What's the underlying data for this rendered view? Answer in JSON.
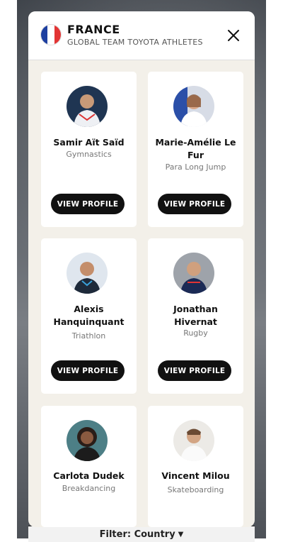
{
  "modal": {
    "title": "FRANCE",
    "subtitle": "GLOBAL TEAM TOYOTA ATHLETES",
    "flag_colors": [
      "#1d3fa0",
      "#ffffff",
      "#e23434"
    ]
  },
  "athletes": [
    {
      "name": "Samir Aït Saïd",
      "sport": "Gymnastics",
      "button": "VIEW PROFILE"
    },
    {
      "name": "Marie-Amélie Le Fur",
      "sport": "Para Long Jump",
      "button": "VIEW PROFILE"
    },
    {
      "name": "Alexis Hanquinquant",
      "sport": "Triathlon",
      "button": "VIEW PROFILE"
    },
    {
      "name": "Jonathan Hivernat",
      "sport": "Rugby",
      "button": "VIEW PROFILE"
    },
    {
      "name": "Carlota Dudek",
      "sport": "Breakdancing"
    },
    {
      "name": "Vincent Milou",
      "sport": "Skateboarding"
    }
  ],
  "filter": {
    "label": "Filter: Country"
  }
}
